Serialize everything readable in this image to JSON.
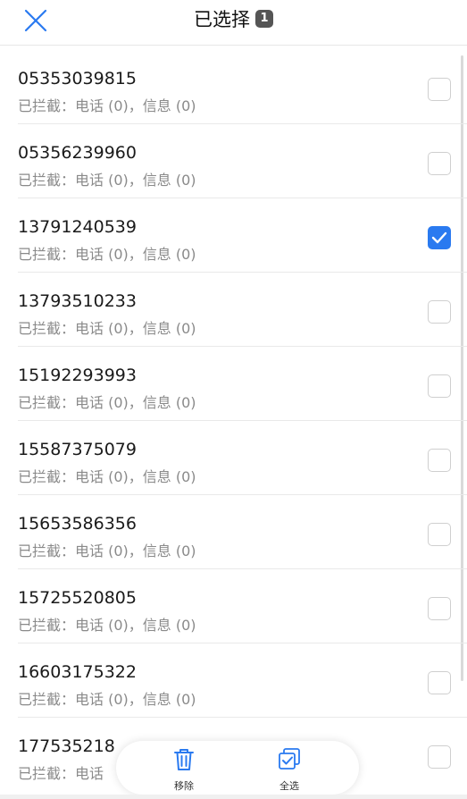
{
  "header": {
    "title": "已选择",
    "selected_count": "1",
    "close_icon": "close-icon"
  },
  "contacts": [
    {
      "number": "05353039815",
      "status": "已拦截：电话 (0)，信息 (0)",
      "checked": false
    },
    {
      "number": "05356239960",
      "status": "已拦截：电话 (0)，信息 (0)",
      "checked": false
    },
    {
      "number": "13791240539",
      "status": "已拦截：电话 (0)，信息 (0)",
      "checked": true
    },
    {
      "number": "13793510233",
      "status": "已拦截：电话 (0)，信息 (0)",
      "checked": false
    },
    {
      "number": "15192293993",
      "status": "已拦截：电话 (0)，信息 (0)",
      "checked": false
    },
    {
      "number": "15587375079",
      "status": "已拦截：电话 (0)，信息 (0)",
      "checked": false
    },
    {
      "number": "15653586356",
      "status": "已拦截：电话 (0)，信息 (0)",
      "checked": false
    },
    {
      "number": "15725520805",
      "status": "已拦截：电话 (0)，信息 (0)",
      "checked": false
    },
    {
      "number": "16603175322",
      "status": "已拦截：电话 (0)，信息 (0)",
      "checked": false
    },
    {
      "number": "177535218",
      "status": "已拦截：电话",
      "checked": false
    }
  ],
  "actions": {
    "remove_label": "移除",
    "select_all_label": "全选"
  },
  "colors": {
    "accent": "#2a7af0",
    "text_primary": "#1a1a1a",
    "text_secondary": "#8a8a8a"
  }
}
